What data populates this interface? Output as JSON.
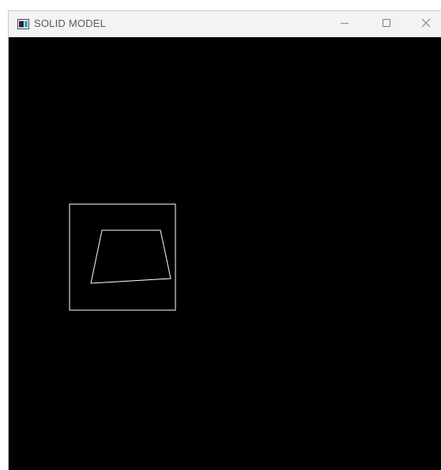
{
  "window": {
    "title": "SOLID MODEL",
    "app_icon": "opengl-window-icon",
    "controls": {
      "minimize_icon": "minimize-icon",
      "maximize_icon": "maximize-icon",
      "close_icon": "close-icon"
    }
  },
  "canvas": {
    "background_color": "#000000",
    "stroke_color": "#ffffff",
    "shapes": [
      "bounding-square",
      "trapezoid-outline"
    ]
  }
}
